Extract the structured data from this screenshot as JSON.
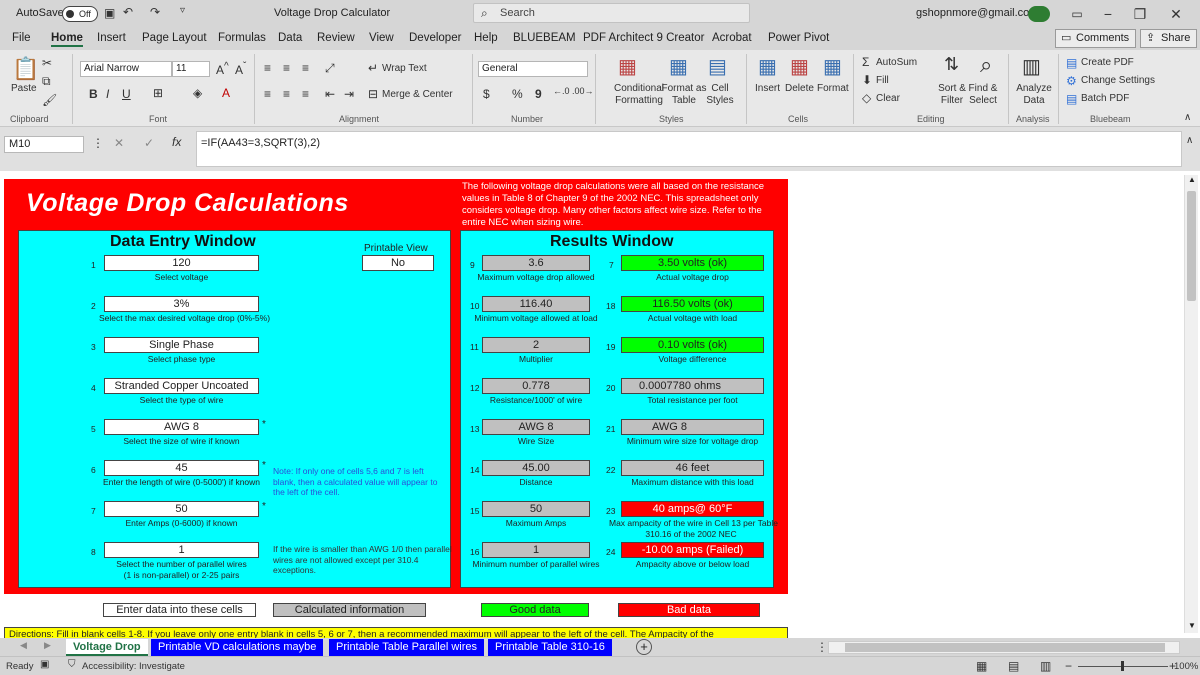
{
  "titlebar": {
    "autosave_label": "AutoSave",
    "autosave_state": "Off",
    "doc_title": "Voltage Drop Calculator",
    "search_placeholder": "Search",
    "account": "gshopnmore@gmail.com"
  },
  "menu": [
    "File",
    "Home",
    "Insert",
    "Page Layout",
    "Formulas",
    "Data",
    "Review",
    "View",
    "Developer",
    "Help",
    "BLUEBEAM",
    "PDF Architect 9 Creator",
    "Acrobat",
    "Power Pivot"
  ],
  "menu_active": "Home",
  "comments_label": "Comments",
  "share_label": "Share",
  "ribbon": {
    "paste": "Paste",
    "font_name": "Arial Narrow",
    "font_size": "11",
    "wrap_text": "Wrap Text",
    "merge_center": "Merge & Center",
    "number_format": "General",
    "conditional_formatting": "Conditional Formatting",
    "format_as_table": "Format as Table",
    "cell_styles": "Cell Styles",
    "insert": "Insert",
    "delete": "Delete",
    "format": "Format",
    "autosum": "AutoSum",
    "fill": "Fill",
    "clear": "Clear",
    "sort_filter": "Sort & Filter",
    "find_select": "Find & Select",
    "analyze_data": "Analyze Data",
    "create_pdf": "Create PDF",
    "change_settings": "Change Settings",
    "batch_pdf": "Batch PDF",
    "groups": [
      "Clipboard",
      "Font",
      "Alignment",
      "Number",
      "Styles",
      "Cells",
      "Editing",
      "Analysis",
      "Bluebeam"
    ]
  },
  "formula_bar": {
    "name_box": "M10",
    "formula": "=IF(AA43=3,SQRT(3),2)"
  },
  "sheet": {
    "title": "Voltage Drop Calculations",
    "description": "The following voltage drop calculations were all based on the resistance values in Table 8 of Chapter 9 of the 2002 NEC. This spreadsheet only considers voltage drop.  Many other factors affect wire size.  Refer to the entire NEC when sizing wire.",
    "data_entry_title": "Data Entry Window",
    "results_title": "Results Window",
    "printable_view_label": "Printable View",
    "printable_view_value": "No",
    "inputs": [
      {
        "n": "1",
        "value": "120",
        "label": "Select voltage"
      },
      {
        "n": "2",
        "value": "3%",
        "label": "Select the max desired voltage drop (0%-5%)"
      },
      {
        "n": "3",
        "value": "Single Phase",
        "label": "Select phase type"
      },
      {
        "n": "4",
        "value": "Stranded Copper Uncoated",
        "label": "Select the type of wire"
      },
      {
        "n": "5",
        "value": "AWG 8",
        "label": "Select the size of wire if known"
      },
      {
        "n": "6",
        "value": "45",
        "label": "Enter the length of wire (0-5000') if known"
      },
      {
        "n": "7",
        "value": "50",
        "label": "Enter Amps (0-6000) if known"
      },
      {
        "n": "8",
        "value": "1",
        "label": "Select the number of parallel wires",
        "label2": "(1 is non-parallel) or 2-25 pairs"
      }
    ],
    "note_blank": "Note:  If only one of cells 5,6 and 7 is left blank, then a calculated value will appear to the left of the cell.",
    "note_parallel": "If the wire is smaller than AWG 1/0 then parallel wires are not allowed except per 310.4 exceptions.",
    "results_left": [
      {
        "n": "9",
        "value": "3.6",
        "label": "Maximum voltage drop allowed"
      },
      {
        "n": "10",
        "value": "116.40",
        "label": "Minimum voltage allowed at load"
      },
      {
        "n": "11",
        "value": "2",
        "label": "Multiplier"
      },
      {
        "n": "12",
        "value": "0.778",
        "label": "Resistance/1000' of wire"
      },
      {
        "n": "13",
        "value": "AWG 8",
        "label": "Wire Size"
      },
      {
        "n": "14",
        "value": "45.00",
        "label": "Distance"
      },
      {
        "n": "15",
        "value": "50",
        "label": "Maximum Amps"
      },
      {
        "n": "16",
        "value": "1",
        "label": "Minimum number of parallel wires"
      }
    ],
    "results_right": [
      {
        "n": "7",
        "value": "3.50  volts (ok)",
        "label": "Actual voltage drop",
        "status": "good"
      },
      {
        "n": "18",
        "value": "116.50  volts (ok)",
        "label": "Actual voltage with load",
        "status": "good"
      },
      {
        "n": "19",
        "value": "0.10  volts (ok)",
        "label": "Voltage difference",
        "status": "good"
      },
      {
        "n": "20",
        "value": "0.0007780  ohms",
        "label": "Total resistance per foot",
        "status": "calc"
      },
      {
        "n": "21",
        "value": "AWG 8",
        "label": "Minimum wire size for voltage drop",
        "status": "calc"
      },
      {
        "n": "22",
        "value": "46  feet",
        "label": "Maximum distance with this load",
        "status": "calc"
      },
      {
        "n": "23",
        "value": "40  amps@ 60°F",
        "label": "Max ampacity of the wire in Cell 13 per Table",
        "label2": "310.16 of the 2002 NEC",
        "status": "bad"
      },
      {
        "n": "24",
        "value": "-10.00  amps (Failed)",
        "label": "Ampacity above or below load",
        "status": "bad"
      }
    ],
    "legend": {
      "enter": "Enter data into these cells",
      "calculated": "Calculated information",
      "good": "Good data",
      "bad": "Bad data"
    },
    "directions": "Directions:  Fill in blank cells 1-8.  If you leave only one entry blank in cells 5, 6 or 7, then a recommended maximum will appear to the left of the cell.  The Ampacity of the"
  },
  "tabs": [
    "Voltage Drop",
    "Printable VD calculations maybe",
    "Printable Table Parallel wires",
    "Printable Table 310-16"
  ],
  "tab_active": 0,
  "status": {
    "ready": "Ready",
    "accessibility": "Accessibility: Investigate",
    "zoom": "100%"
  }
}
